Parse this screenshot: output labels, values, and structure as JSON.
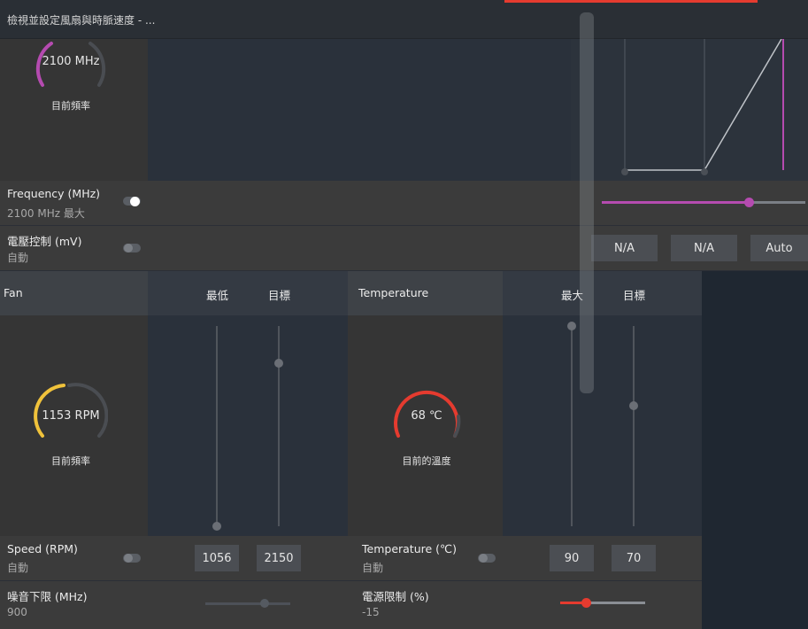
{
  "colors": {
    "accent_red": "#e53b2f",
    "accent_purple": "#b54bb0",
    "accent_yellow": "#f0c23b"
  },
  "window": {
    "title": "檢視並設定風扇與時脈速度 - ..."
  },
  "clock": {
    "gauge": {
      "value": "2100 MHz",
      "caption": "目前頻率"
    },
    "frequency": {
      "label": "Frequency (MHz)",
      "value": "2100 MHz 最大",
      "slider_level": 0.72
    },
    "voltage": {
      "label": "電壓控制 (mV)",
      "value": "自動",
      "buttons": [
        "N/A",
        "N/A",
        "Auto"
      ]
    }
  },
  "fan": {
    "title": "Fan",
    "col_min": "最低",
    "col_target": "目標",
    "gauge": {
      "value": "1153 RPM",
      "caption": "目前頻率"
    },
    "speed": {
      "label": "Speed (RPM)",
      "value": "自動",
      "min": "1056",
      "target": "2150"
    },
    "noise": {
      "label": "噪音下限 (MHz)",
      "value": "900"
    }
  },
  "temperature": {
    "title": "Temperature",
    "col_max": "最大",
    "col_target": "目標",
    "gauge": {
      "value": "68 ℃",
      "caption": "目前的溫度"
    },
    "temp": {
      "label": "Temperature (℃)",
      "value": "自動",
      "max": "90",
      "target": "70"
    },
    "power": {
      "label": "電源限制 (%)",
      "value": "-15",
      "slider_level": 0.3
    }
  }
}
